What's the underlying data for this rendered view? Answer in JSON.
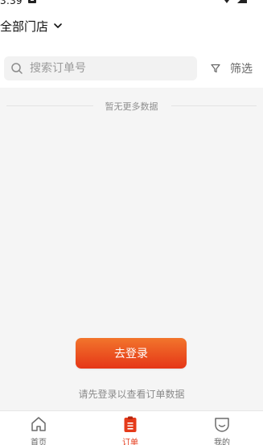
{
  "status_bar": {
    "time": "3:39"
  },
  "header": {
    "store_selector_label": "全部门店"
  },
  "search": {
    "placeholder": "搜索订单号",
    "value": ""
  },
  "filter": {
    "label": "筛选"
  },
  "list": {
    "no_more_text": "暂无更多数据"
  },
  "login": {
    "button_label": "去登录",
    "hint": "请先登录以查看订单数据"
  },
  "tab_bar": {
    "active_color": "#e53a1a",
    "items": [
      {
        "label": "首页",
        "icon": "home-icon",
        "active": false
      },
      {
        "label": "订单",
        "icon": "clipboard-icon",
        "active": true
      },
      {
        "label": "我的",
        "icon": "profile-face-icon",
        "active": false
      }
    ]
  },
  "colors": {
    "accent_gradient_start": "#f2752c",
    "accent_gradient_end": "#e53617"
  }
}
